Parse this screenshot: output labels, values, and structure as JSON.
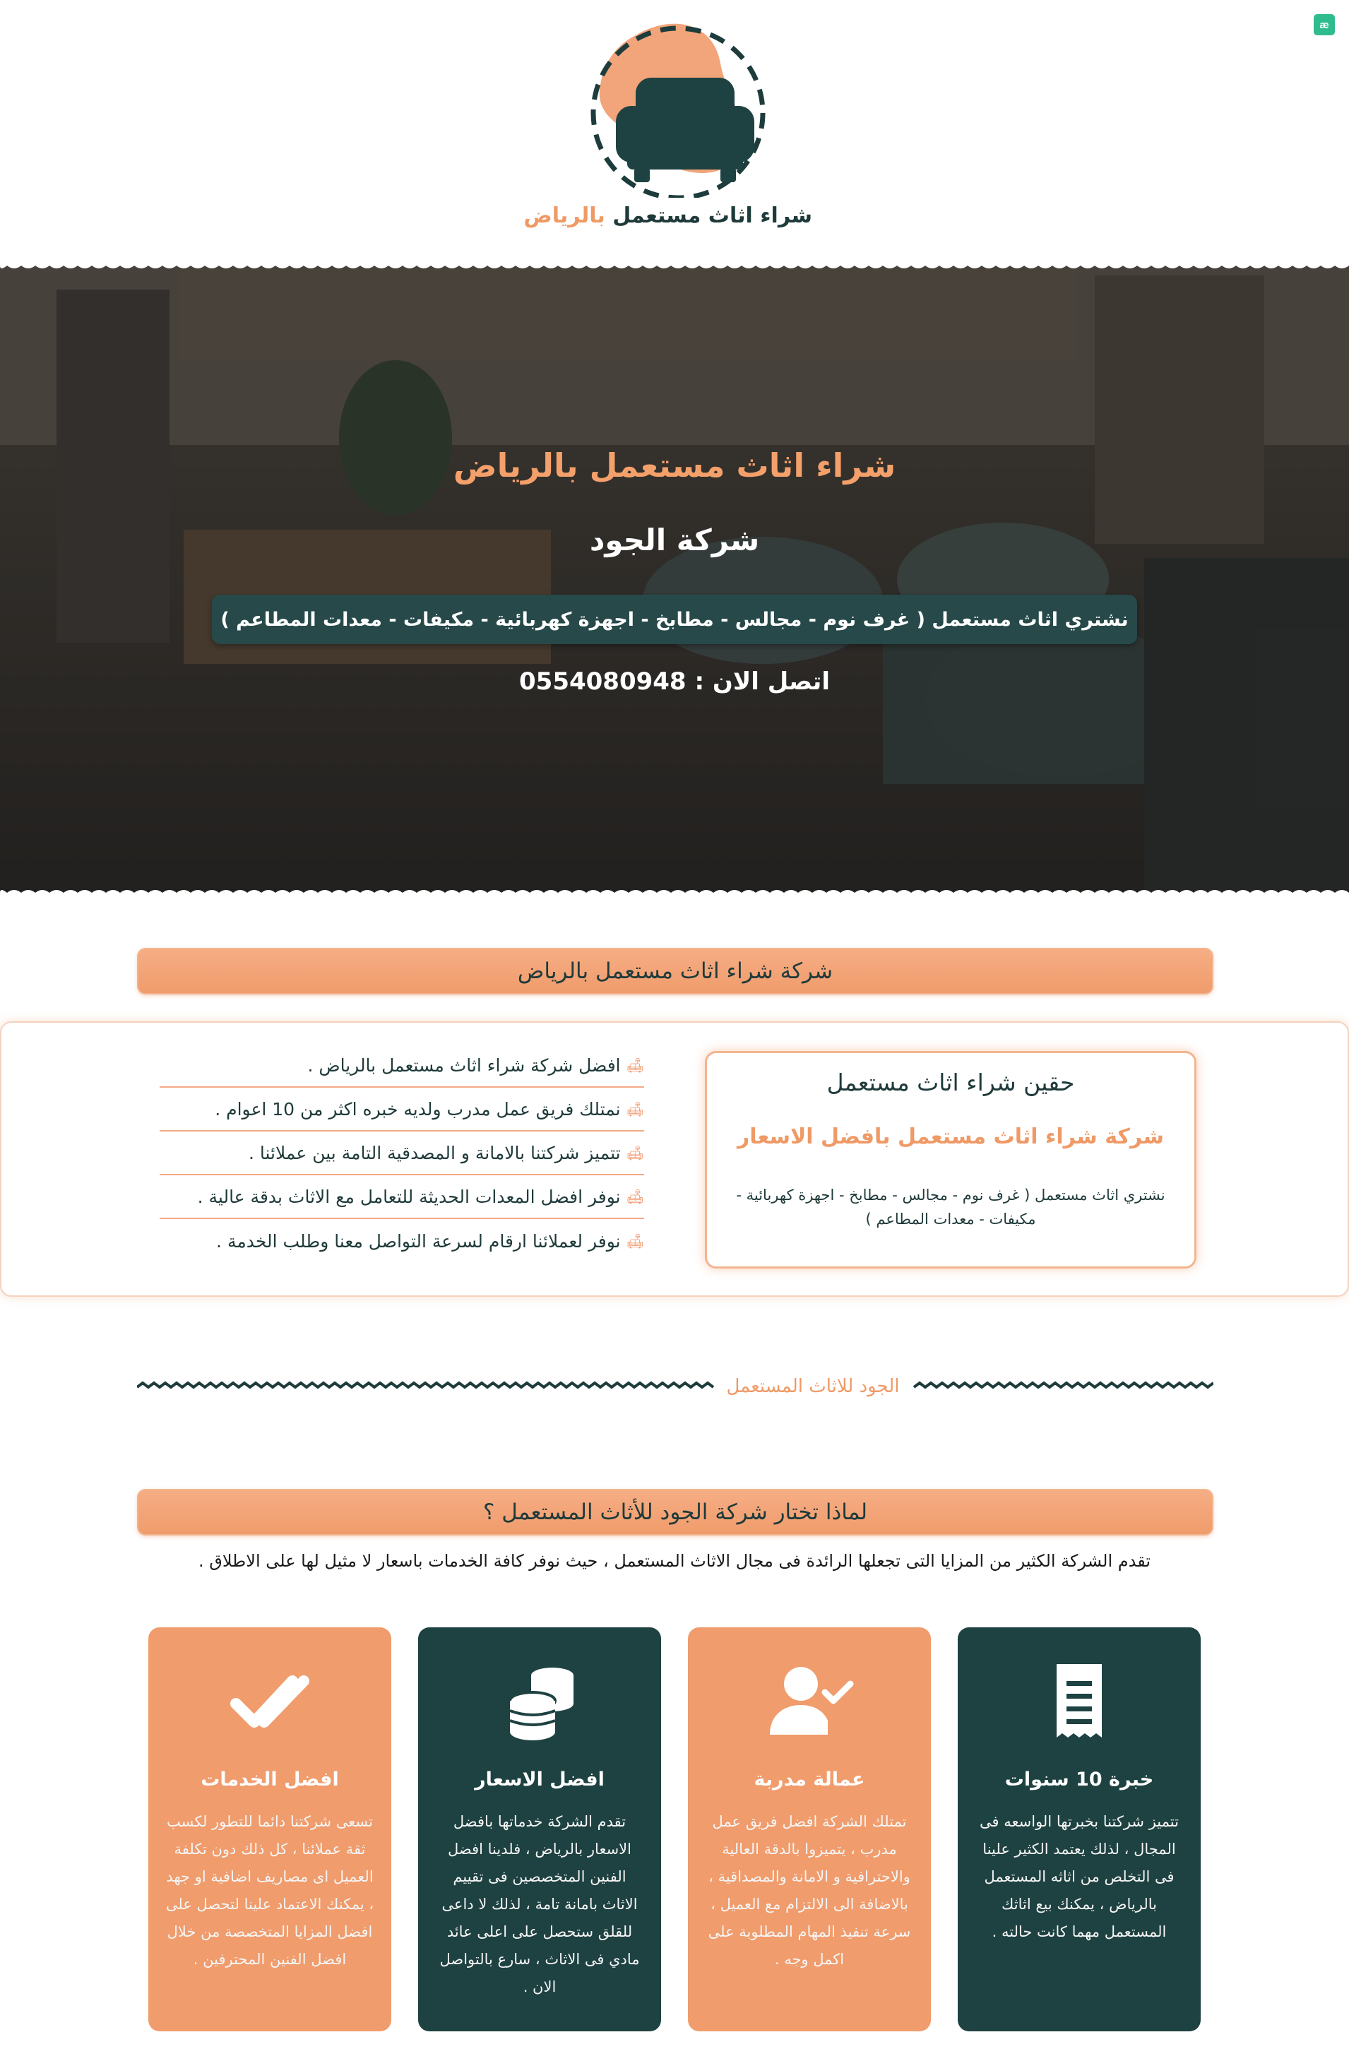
{
  "top_badge": "æ",
  "logo": {
    "text_main": "شراء اثاث مستعمل",
    "text_accent": "بالرياض"
  },
  "hero": {
    "title": "شراء اثاث مستعمل بالرياض",
    "subtitle": "شركة الجود",
    "band": "نشتري اثاث مستعمل ( غرف نوم - مجالس - مطابخ - اجهزة كهربائية - مكيفات - معدات المطاعم )",
    "call_label": "اتصل الان :",
    "phone": "0554080948"
  },
  "section_about": {
    "title": "شركة شراء اثاث مستعمل بالرياض",
    "card_title": "حقين شراء اثاث مستعمل",
    "card_subtitle": "شركة شراء اثاث مستعمل بافضل الاسعار",
    "card_desc": "نشتري اثاث مستعمل ( غرف نوم - مجالس - مطابخ - اجهزة كهربائية - مكيفات - معدات المطاعم )",
    "features": [
      "افضل شركة شراء اثاث مستعمل بالرياض .",
      "نمتلك فريق عمل مدرب ولديه خبره اكثر من 10 اعوام .",
      "تتميز شركتنا بالامانة و المصدقية التامة بين عملائنا .",
      "نوفر افضل المعدات الحديثة للتعامل مع الاثاث بدقة عالية .",
      "نوفر لعملائنا ارقام لسرعة التواصل معنا وطلب الخدمة ."
    ]
  },
  "divider_text": "الجود للاثاث المستعمل",
  "section_why": {
    "title": "لماذا تختار شركة الجود للأثاث المستعمل ؟",
    "desc": "تقدم الشركة الكثير من المزايا التى تجعلها الرائدة فى مجال الاثاث المستعمل ، حيث نوفر كافة الخدمات باسعار لا مثيل لها على الاطلاق ."
  },
  "cards": [
    {
      "icon": "receipt-icon",
      "title": "خبرة 10 سنوات",
      "text": "تتميز شركتنا بخبرتها الواسعه فى المجال ، لذلك يعتمد الكثير علينا فى التخلص من اثاثه المستعمل بالرياض ، يمكنك بيع اثاثك المستعمل مهما كانت حالته ."
    },
    {
      "icon": "user-check-icon",
      "title": "عمالة مدربة",
      "text": "تمتلك الشركة افضل فريق عمل مدرب ، يتميزوا بالدقة العالية والاحترافية و الامانة والمصداقية ، بالاضافة الى الالتزام مع العميل ، سرعة تنفيذ المهام المطلوبة على اكمل وجه ."
    },
    {
      "icon": "coins-icon",
      "title": "افضل الاسعار",
      "text": "تقدم الشركة خدماتها بافضل الاسعار بالرياض ، فلدينا افضل الفنين المتخصصين فى تقييم الاثاث بامانة تامة ، لذلك لا داعى للقلق ستحصل على اعلى عائد مادي فى الاثاث ، سارع بالتواصل الان ."
    },
    {
      "icon": "double-check-icon",
      "title": "افضل الخدمات",
      "text": "تسعى شركتنا دائما للتطور لكسب ثقة عملائنا ، كل ذلك دون تكلفة العميل اى مصاريف اضافية او جهد ، يمكنك الاعتماد علينا لتحصل على افضل المزايا المتخصصة من خلال افضل الفنين المحترفين ."
    }
  ],
  "colors": {
    "brand_dark": "#1e4141",
    "brand_orange": "#f09c6c",
    "accent_text": "#ef9a66"
  }
}
